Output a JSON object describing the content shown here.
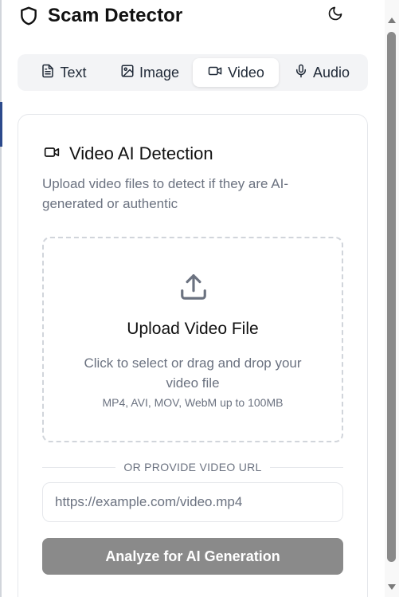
{
  "app": {
    "title": "Scam Detector"
  },
  "tabs": [
    {
      "label": "Text",
      "icon": "file-text-icon",
      "active": false
    },
    {
      "label": "Image",
      "icon": "image-icon",
      "active": false
    },
    {
      "label": "Video",
      "icon": "video-icon",
      "active": true
    },
    {
      "label": "Audio",
      "icon": "mic-icon",
      "active": false
    }
  ],
  "card": {
    "title": "Video AI Detection",
    "description": "Upload video files to detect if they are AI-generated or authentic",
    "dropzone": {
      "title": "Upload Video File",
      "subtitle": "Click to select or drag and drop your video file",
      "formats": "MP4, AVI, MOV, WebM up to 100MB"
    },
    "divider_text": "OR PROVIDE VIDEO URL",
    "url_input": {
      "placeholder": "https://example.com/video.mp4",
      "value": ""
    },
    "analyze_label": "Analyze for AI Generation"
  },
  "colors": {
    "accent_disabled": "#8a8a8a",
    "text_muted": "#6b7280",
    "border": "#e5e7eb",
    "tab_bg": "#f3f4f6"
  }
}
